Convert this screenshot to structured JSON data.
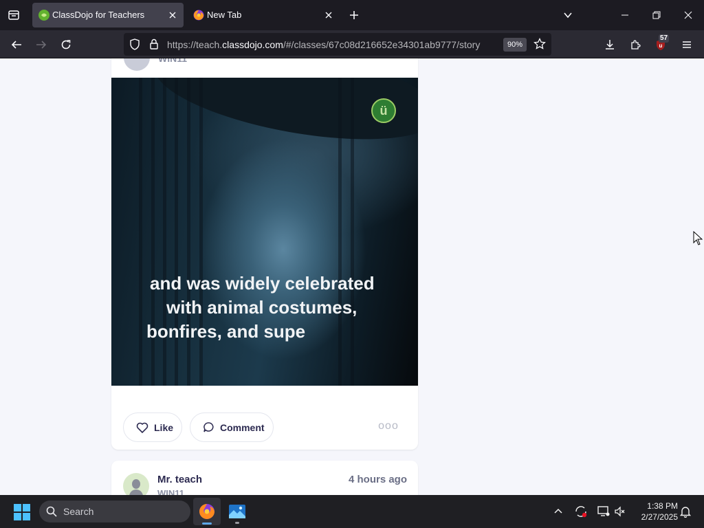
{
  "browser": {
    "tabs": [
      {
        "title": "ClassDojo for Teachers",
        "active": true
      },
      {
        "title": "New Tab",
        "active": false
      }
    ],
    "url": {
      "prefix": "https://teach.",
      "domain": "classdojo.com",
      "path": "/#/classes/67c08d216652e34301ab9777/story"
    },
    "zoom": "90%",
    "extension_badge": "57",
    "colors": {
      "tabbar": "#1c1b22",
      "navbar": "#2b2a33",
      "active_tab": "#42414d"
    }
  },
  "feed": {
    "post1": {
      "class_name": "WIN11",
      "caption_lines": [
        "and was widely celebrated",
        "with animal costumes,",
        "bonfires, and supe"
      ],
      "logo_letter": "ü",
      "like_label": "Like",
      "comment_label": "Comment",
      "more_label": "ooo"
    },
    "post2": {
      "author": "Mr. teach",
      "class_name": "WIN11",
      "time": "4 hours ago"
    }
  },
  "taskbar": {
    "search_placeholder": "Search",
    "time": "1:38 PM",
    "date": "2/27/2025",
    "apps": [
      "firefox-icon",
      "photos-icon"
    ]
  },
  "colors": {
    "page_bg": "#f5f6fb",
    "card_bg": "#ffffff",
    "text_primary": "#2c2a50",
    "text_muted": "#8a8fa3"
  }
}
